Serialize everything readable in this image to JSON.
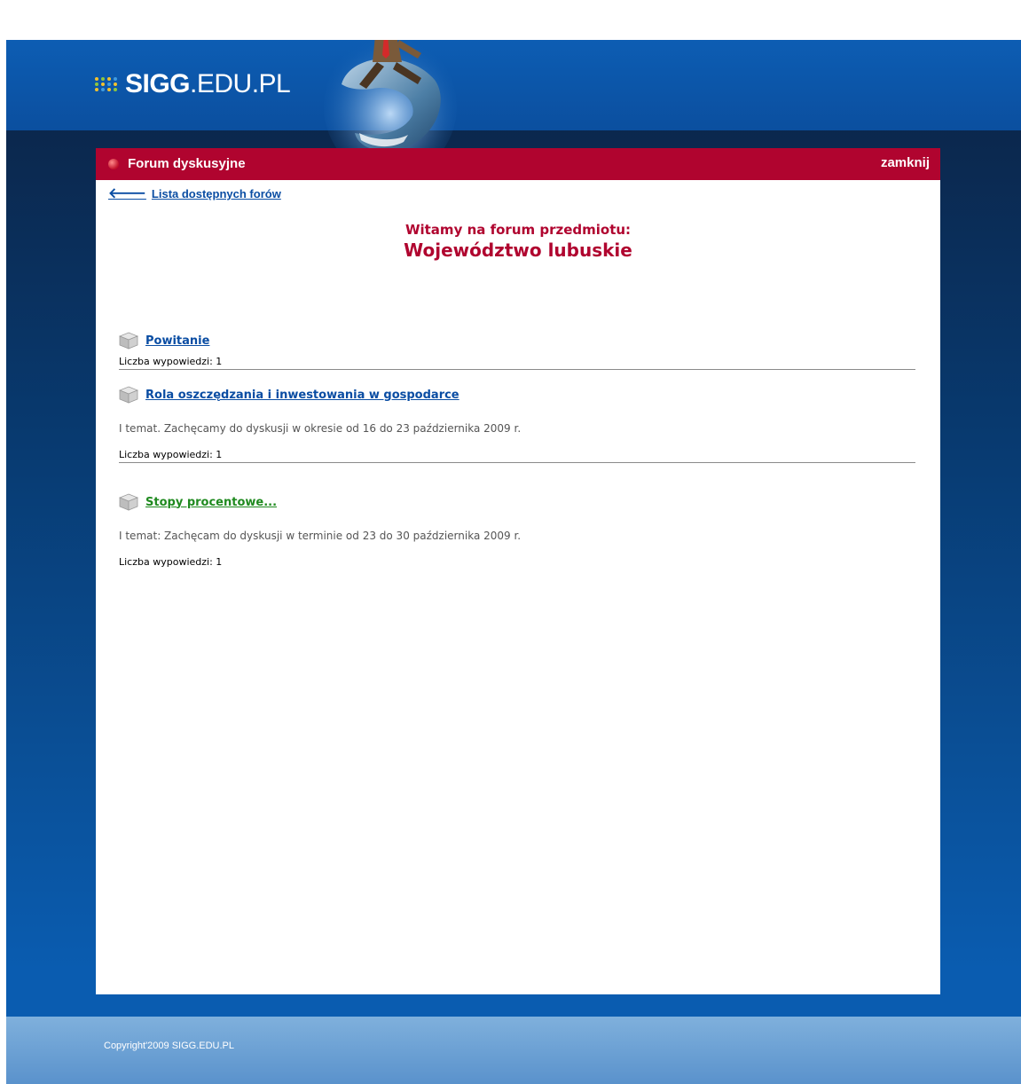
{
  "site": {
    "logo_strong": "SIGG",
    "logo_rest": ".EDU.PL"
  },
  "panel": {
    "title": "Forum dyskusyjne",
    "close_label": "zamknij",
    "back_label": "Lista dostępnych forów"
  },
  "welcome": {
    "line1": "Witamy na forum przedmiotu:",
    "line2": "Województwo lubuskie"
  },
  "forums": [
    {
      "title": "Powitanie",
      "desc": "",
      "count": "Liczba wypowiedzi: 1"
    },
    {
      "title": "Rola oszczędzania i inwestowania w gospodarce",
      "desc": "I temat. Zachęcamy do dyskusji w okresie od 16 do 23 października 2009 r.",
      "count": "Liczba wypowiedzi: 1"
    },
    {
      "title": "Stopy procentowe...",
      "desc": "I temat: Zachęcam do dyskusji w terminie od 23 do 30 października 2009 r.",
      "count": "Liczba wypowiedzi: 1"
    }
  ],
  "footer": {
    "copyright": "Copyright'2009 SIGG.EDU.PL"
  },
  "colors": {
    "accent_red": "#b0042f",
    "link_blue": "#0a4da3",
    "link_green": "#1f8a1f",
    "page_blue": "#0a5cb0"
  }
}
